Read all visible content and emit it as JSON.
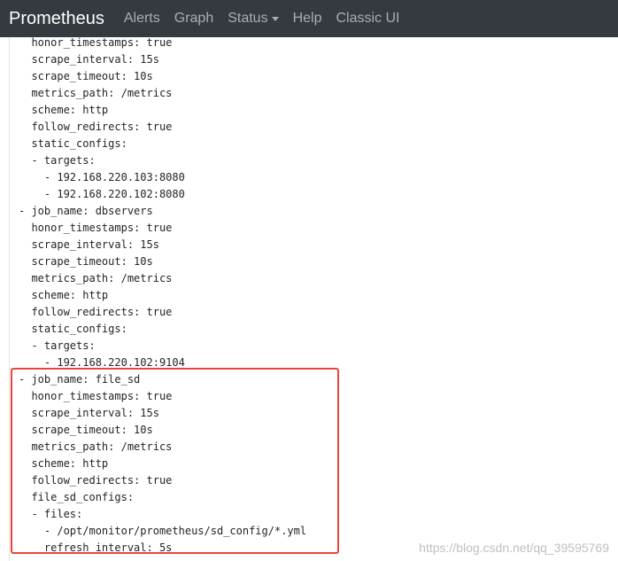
{
  "navbar": {
    "brand": "Prometheus",
    "links": [
      "Alerts",
      "Graph",
      "Status",
      "Help",
      "Classic UI"
    ]
  },
  "config_lines": [
    "  honor_timestamps: true",
    "  scrape_interval: 15s",
    "  scrape_timeout: 10s",
    "  metrics_path: /metrics",
    "  scheme: http",
    "  follow_redirects: true",
    "  static_configs:",
    "  - targets:",
    "    - 192.168.220.103:8080",
    "    - 192.168.220.102:8080",
    "- job_name: dbservers",
    "  honor_timestamps: true",
    "  scrape_interval: 15s",
    "  scrape_timeout: 10s",
    "  metrics_path: /metrics",
    "  scheme: http",
    "  follow_redirects: true",
    "  static_configs:",
    "  - targets:",
    "    - 192.168.220.102:9104",
    "- job_name: file_sd",
    "  honor_timestamps: true",
    "  scrape_interval: 15s",
    "  scrape_timeout: 10s",
    "  metrics_path: /metrics",
    "  scheme: http",
    "  follow_redirects: true",
    "  file_sd_configs:",
    "  - files:",
    "    - /opt/monitor/prometheus/sd_config/*.yml",
    "    refresh_interval: 5s"
  ],
  "watermark": "https://blog.csdn.net/qq_39595769",
  "colors": {
    "navbar_bg": "#343a40",
    "highlight_border": "#e8463c"
  }
}
